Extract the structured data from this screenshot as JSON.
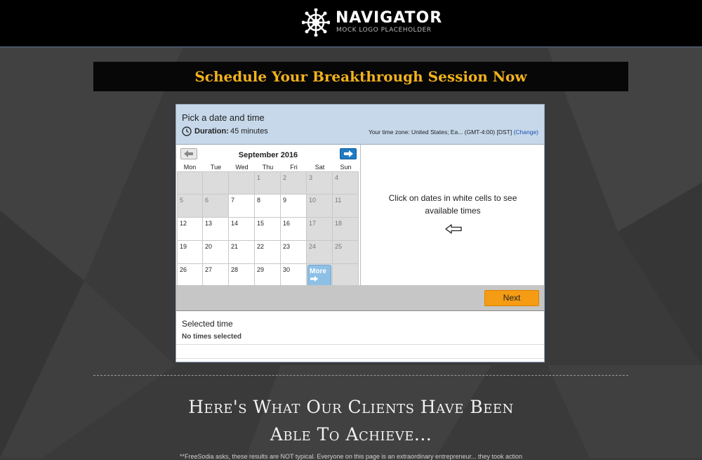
{
  "header": {
    "logo_title": "NAVIGATOR",
    "logo_subtitle": "MOCK LOGO PLACEHOLDER",
    "logo_icon": "ship-wheel-icon"
  },
  "banner": {
    "title": "Schedule Your Breakthrough Session Now"
  },
  "scheduler": {
    "title": "Pick a date and time",
    "duration_label": "Duration:",
    "duration_value": "45 minutes",
    "timezone_text": "Your time zone: United States; Ea... (GMT-4:00) [DST]",
    "timezone_change": "(Change)",
    "calendar": {
      "month": "September 2016",
      "weekdays": [
        "Mon",
        "Tue",
        "Wed",
        "Thu",
        "Fri",
        "Sat",
        "Sun"
      ],
      "weeks": [
        [
          {
            "d": "",
            "s": "gray"
          },
          {
            "d": "",
            "s": "gray"
          },
          {
            "d": "",
            "s": "gray"
          },
          {
            "d": "1",
            "s": "gray"
          },
          {
            "d": "2",
            "s": "gray"
          },
          {
            "d": "3",
            "s": "gray"
          },
          {
            "d": "4",
            "s": "gray"
          }
        ],
        [
          {
            "d": "5",
            "s": "gray"
          },
          {
            "d": "6",
            "s": "gray"
          },
          {
            "d": "7",
            "s": "white"
          },
          {
            "d": "8",
            "s": "white"
          },
          {
            "d": "9",
            "s": "white"
          },
          {
            "d": "10",
            "s": "gray"
          },
          {
            "d": "11",
            "s": "gray"
          }
        ],
        [
          {
            "d": "12",
            "s": "white"
          },
          {
            "d": "13",
            "s": "white"
          },
          {
            "d": "14",
            "s": "white"
          },
          {
            "d": "15",
            "s": "white"
          },
          {
            "d": "16",
            "s": "white"
          },
          {
            "d": "17",
            "s": "gray"
          },
          {
            "d": "18",
            "s": "gray"
          }
        ],
        [
          {
            "d": "19",
            "s": "white"
          },
          {
            "d": "20",
            "s": "white"
          },
          {
            "d": "21",
            "s": "white"
          },
          {
            "d": "22",
            "s": "white"
          },
          {
            "d": "23",
            "s": "white"
          },
          {
            "d": "24",
            "s": "gray"
          },
          {
            "d": "25",
            "s": "gray"
          }
        ],
        [
          {
            "d": "26",
            "s": "white"
          },
          {
            "d": "27",
            "s": "white"
          },
          {
            "d": "28",
            "s": "white"
          },
          {
            "d": "29",
            "s": "white"
          },
          {
            "d": "30",
            "s": "white"
          },
          {
            "d": "",
            "s": "more"
          },
          {
            "d": "",
            "s": "gray"
          }
        ]
      ],
      "more_label": "More",
      "prev_icon": "arrow-left-icon",
      "next_icon": "arrow-right-icon"
    },
    "hint": "Click on dates in white cells to see available times",
    "next_button": "Next",
    "selected_time_label": "Selected time",
    "selected_time_value": "No times selected"
  },
  "section": {
    "headline_line1": "Here's What Our Clients Have Been",
    "headline_line2": "Able To Achieve...",
    "disclaimer": "**FreeSodia asks, these results are NOT typical. Everyone on this page is an extraordinary entrepreneur... they took action"
  },
  "colors": {
    "accent_gold": "#f2b21d",
    "widget_header": "#c6d8ea",
    "next_orange": "#f59c14",
    "link_blue": "#1f4fb4"
  }
}
